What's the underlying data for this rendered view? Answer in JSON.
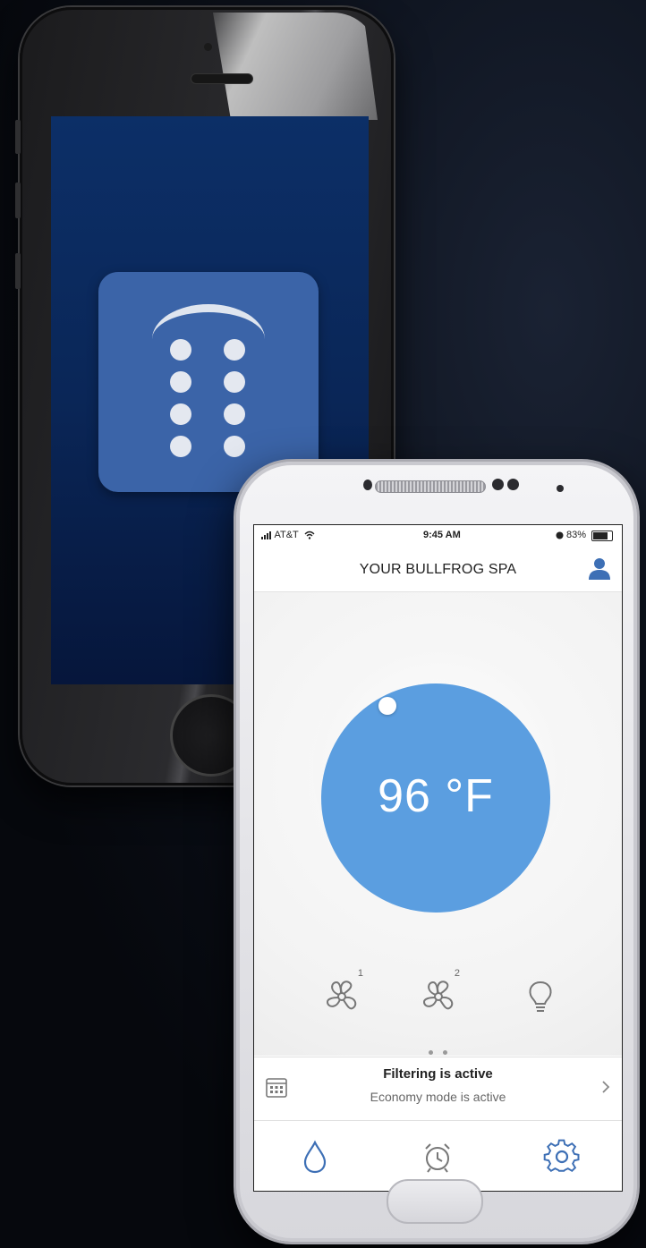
{
  "brand_colors": {
    "app_blue": "#3b64a8",
    "dial_blue": "#5b9ee0",
    "splash_navy": "#0a2657"
  },
  "back_phone": {
    "splash_icon": "remote-control-app-icon"
  },
  "front_phone": {
    "status_bar": {
      "carrier": "AT&T",
      "time": "9:45 AM",
      "battery": "83%"
    },
    "header": {
      "title": "YOUR BULLFROG SPA",
      "profile_icon": "user-icon"
    },
    "temperature": {
      "value": "96 °F"
    },
    "controls": [
      {
        "icon": "fan-icon",
        "badge": "1"
      },
      {
        "icon": "fan-icon",
        "badge": "2"
      },
      {
        "icon": "lightbulb-icon",
        "badge": ""
      }
    ],
    "status": {
      "primary": "Filtering is active",
      "secondary": "Economy mode is active"
    },
    "tabs": [
      {
        "icon": "water-drop-icon"
      },
      {
        "icon": "alarm-clock-icon"
      },
      {
        "icon": "settings-gear-icon"
      }
    ]
  }
}
